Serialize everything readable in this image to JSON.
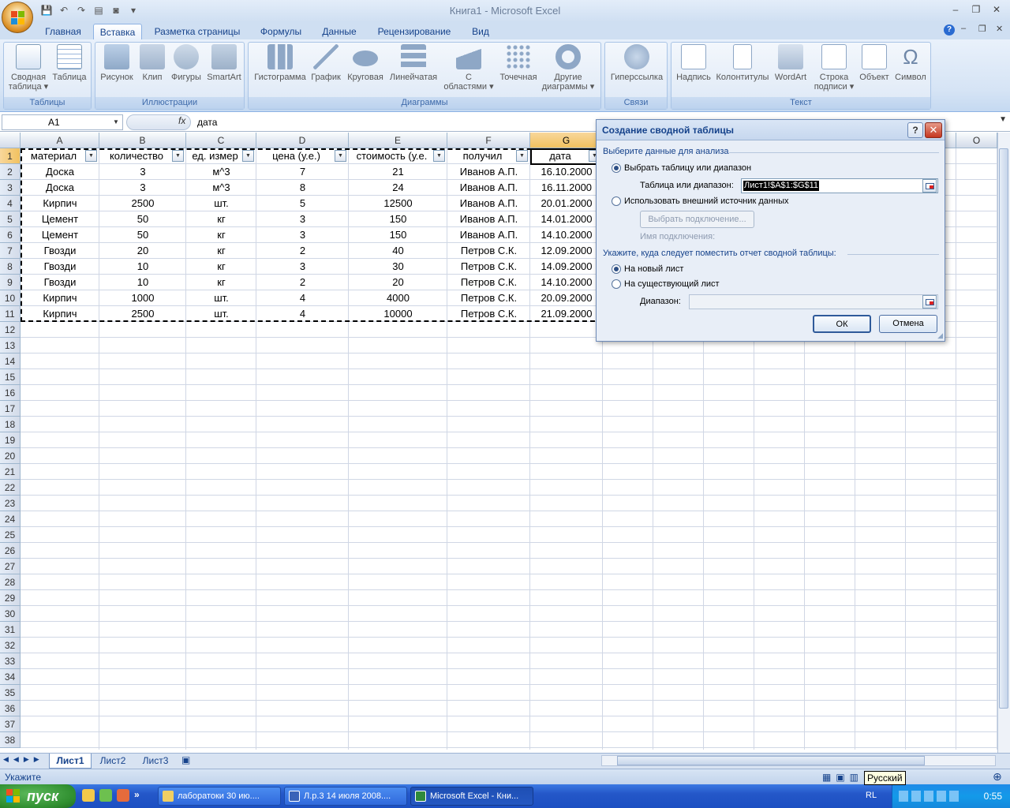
{
  "window": {
    "title": "Книга1 - Microsoft Excel"
  },
  "ribbon_tabs": [
    "Главная",
    "Вставка",
    "Разметка страницы",
    "Формулы",
    "Данные",
    "Рецензирование",
    "Вид"
  ],
  "active_tab": "Вставка",
  "ribbon": {
    "groups": {
      "tables": "Таблицы",
      "illustrations": "Иллюстрации",
      "charts": "Диаграммы",
      "links": "Связи",
      "text": "Текст"
    },
    "buttons": {
      "pivot_l1": "Сводная",
      "pivot_l2": "таблица ▾",
      "table": "Таблица",
      "picture": "Рисунок",
      "clip": "Клип",
      "shapes": "Фигуры",
      "smartart": "SmartArt",
      "histogram": "Гистограмма",
      "line": "График",
      "pie": "Круговая",
      "bar": "Линейчатая",
      "area_l1": "С",
      "area_l2": "областями ▾",
      "scatter": "Точечная",
      "other_l1": "Другие",
      "other_l2": "диаграммы ▾",
      "hyperlink": "Гиперссылка",
      "textbox": "Надпись",
      "header_footer": "Колонтитулы",
      "wordart": "WordArt",
      "signature_l1": "Строка",
      "signature_l2": "подписи ▾",
      "object": "Объект",
      "symbol": "Символ",
      "symbol_glyph": "Ω"
    }
  },
  "formula_bar": {
    "name_box": "A1",
    "fx": "fx",
    "value": "дата"
  },
  "columns": [
    "A",
    "B",
    "C",
    "D",
    "E",
    "F",
    "G",
    "O"
  ],
  "sheet": {
    "headers": [
      "материал",
      "количество",
      "ед. измер",
      "цена (у.е.)",
      "стоимость (у.е.",
      "получил",
      "дата"
    ],
    "rows": [
      [
        "Доска",
        "3",
        "м^3",
        "7",
        "21",
        "Иванов А.П.",
        "16.10.2000"
      ],
      [
        "Доска",
        "3",
        "м^3",
        "8",
        "24",
        "Иванов А.П.",
        "16.11.2000"
      ],
      [
        "Кирпич",
        "2500",
        "шт.",
        "5",
        "12500",
        "Иванов А.П.",
        "20.01.2000"
      ],
      [
        "Цемент",
        "50",
        "кг",
        "3",
        "150",
        "Иванов А.П.",
        "14.01.2000"
      ],
      [
        "Цемент",
        "50",
        "кг",
        "3",
        "150",
        "Иванов А.П.",
        "14.10.2000"
      ],
      [
        "Гвозди",
        "20",
        "кг",
        "2",
        "40",
        "Петров С.К.",
        "12.09.2000"
      ],
      [
        "Гвозди",
        "10",
        "кг",
        "3",
        "30",
        "Петров С.К.",
        "14.09.2000"
      ],
      [
        "Гвозди",
        "10",
        "кг",
        "2",
        "20",
        "Петров С.К.",
        "14.10.2000"
      ],
      [
        "Кирпич",
        "1000",
        "шт.",
        "4",
        "4000",
        "Петров С.К.",
        "20.09.2000"
      ],
      [
        "Кирпич",
        "2500",
        "шт.",
        "4",
        "10000",
        "Петров С.К.",
        "21.09.2000"
      ]
    ],
    "row_count": 38
  },
  "sheet_tabs": [
    "Лист1",
    "Лист2",
    "Лист3"
  ],
  "active_sheet": "Лист1",
  "status": {
    "text": "Укажите",
    "language_tooltip": "Русский"
  },
  "dialog": {
    "title": "Создание сводной таблицы",
    "help": "?",
    "close": "✕",
    "section1": "Выберите данные для анализа",
    "opt_select_range": "Выбрать таблицу или диапазон",
    "range_label": "Таблица или диапазон:",
    "range_value": "Лист1!$A$1:$G$11",
    "opt_external": "Использовать внешний источник данных",
    "choose_connection": "Выбрать подключение...",
    "connection_name": "Имя подключения:",
    "section2": "Укажите, куда следует поместить отчет сводной таблицы:",
    "opt_new_sheet": "На новый лист",
    "opt_existing_sheet": "На существующий лист",
    "dest_label": "Диапазон:",
    "ok": "ОК",
    "cancel": "Отмена"
  },
  "taskbar": {
    "start": "пуск",
    "items": [
      "лаборатоки 30 ию....",
      "Л.р.3 14 июля 2008....",
      "Microsoft Excel - Кни..."
    ],
    "tray_lang": "RL",
    "clock": "0:55"
  }
}
